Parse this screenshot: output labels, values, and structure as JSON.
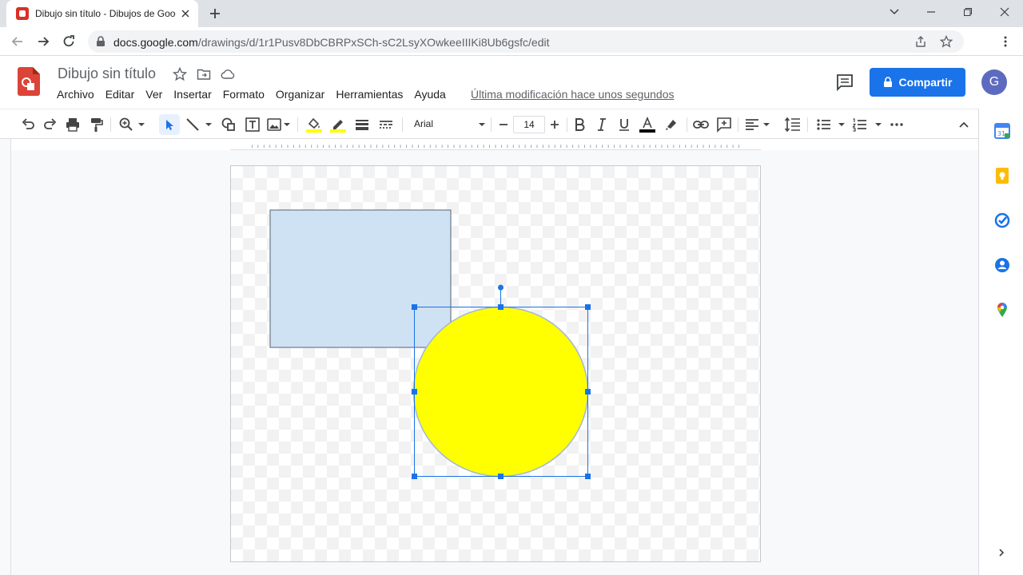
{
  "browser": {
    "tab_title": "Dibujo sin título - Dibujos de Google",
    "url_host": "docs.google.com",
    "url_path": "/drawings/d/1r1Pusv8DbCBRPxSCh-sC2LsyXOwkeeIIIKi8Ub6gsfc/edit"
  },
  "app": {
    "doc_title": "Dibujo sin título",
    "menu": [
      "Archivo",
      "Editar",
      "Ver",
      "Insertar",
      "Formato",
      "Organizar",
      "Herramientas",
      "Ayuda"
    ],
    "last_modified": "Última modificación hace unos segundos",
    "share_label": "Compartir",
    "user_initial": "G"
  },
  "toolbar": {
    "font": "Arial",
    "font_size": "14",
    "fill_color": "#ffff00",
    "line_color": "#ffff00",
    "text_color": "#000000"
  },
  "canvas": {
    "rect_fill": "#cfe2f3",
    "circle_fill": "#ffff00",
    "selection_color": "#1a73e8"
  },
  "side_panel": [
    "calendar-icon",
    "keep-icon",
    "tasks-icon",
    "contacts-icon",
    "maps-icon"
  ]
}
